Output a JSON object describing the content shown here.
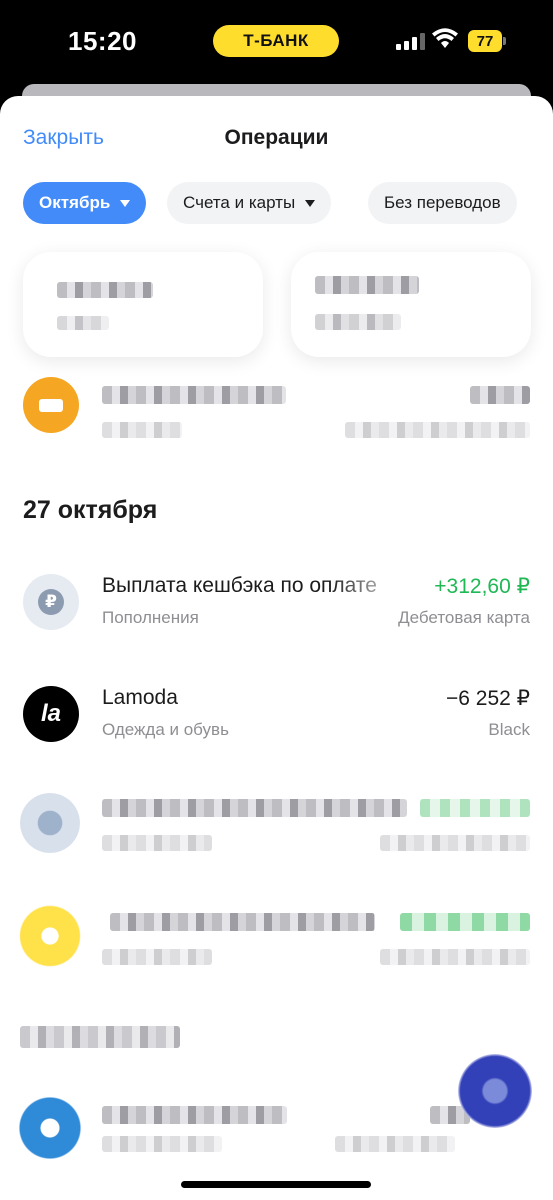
{
  "status_bar": {
    "time": "15:20",
    "bank_badge": "Т-БАНК",
    "battery": "77"
  },
  "header": {
    "close_label": "Закрыть",
    "title": "Операции"
  },
  "filters": {
    "month": "Октябрь",
    "accounts": "Счета и карты",
    "transfers": "Без переводов"
  },
  "date_header": "27 октября",
  "operations": [
    {
      "title": "Выплата кешбэка по оплате",
      "category": "Пополнения",
      "amount": "+312,60 ₽",
      "account": "Дебетовая карта",
      "icon": "ruble-icon",
      "type": "income"
    },
    {
      "title": "Lamoda",
      "category": "Одежда и обувь",
      "amount": "−6 252 ₽",
      "account": "Black",
      "icon": "lamoda-logo",
      "logo_text": "la",
      "type": "expense"
    }
  ],
  "colors": {
    "accent": "#428bf9",
    "income": "#1fb855",
    "bank_yellow": "#ffdd2d",
    "muted": "#8e8e93"
  }
}
